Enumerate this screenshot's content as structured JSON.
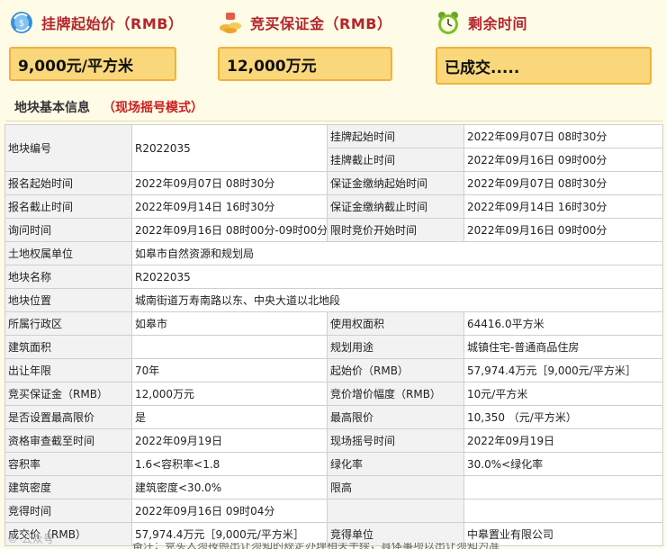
{
  "stats": {
    "price": {
      "label": "挂牌起始价（RMB）",
      "value": "9,000元/平方米",
      "icon": "money-exchange-icon"
    },
    "deposit": {
      "label": "竞买保证金（RMB）",
      "value": "12,000万元",
      "icon": "coins-icon"
    },
    "remaining": {
      "label": "剩余时间",
      "value": "已成交.....",
      "icon": "alarm-clock-icon"
    }
  },
  "section": {
    "title": "地块基本信息",
    "mode": "（现场摇号模式）"
  },
  "table": {
    "r1": {
      "k1": "地块编号",
      "v1": "R2022035",
      "k2a": "挂牌起始时间",
      "v2a": "2022年09月07日 08时30分",
      "k2b": "挂牌截止时间",
      "v2b": "2022年09月16日 09时00分"
    },
    "r2": {
      "k1": "报名起始时间",
      "v1": "2022年09月07日 08时30分",
      "k2": "保证金缴纳起始时间",
      "v2": "2022年09月07日 08时30分"
    },
    "r3": {
      "k1": "报名截止时间",
      "v1": "2022年09月14日 16时30分",
      "k2": "保证金缴纳截止时间",
      "v2": "2022年09月14日 16时30分"
    },
    "r4": {
      "k1": "询问时间",
      "v1": "2022年09月16日 08时00分-09时00分",
      "k2": "限时竞价开始时间",
      "v2": "2022年09月16日 09时00分"
    },
    "r5": {
      "k1": "土地权属单位",
      "v1": "如皋市自然资源和规划局"
    },
    "r6": {
      "k1": "地块名称",
      "v1": "R2022035"
    },
    "r7": {
      "k1": "地块位置",
      "v1": "城南街道万寿南路以东、中央大道以北地段"
    },
    "r8": {
      "k1": "所属行政区",
      "v1": "如皋市",
      "k2": "使用权面积",
      "v2": "64416.0平方米"
    },
    "r9": {
      "k1": "建筑面积",
      "v1": "",
      "k2": "规划用途",
      "v2": "城镇住宅-普通商品住房"
    },
    "r10": {
      "k1": "出让年限",
      "v1": "70年",
      "k2": "起始价（RMB）",
      "v2": "57,974.4万元［9,000元/平方米］"
    },
    "r11": {
      "k1": "竞买保证金（RMB）",
      "v1": "12,000万元",
      "k2": "竞价增价幅度（RMB）",
      "v2": "10元/平方米"
    },
    "r12": {
      "k1": "是否设置最高限价",
      "v1": "是",
      "k2": "最高限价",
      "v2": "10,350 （元/平方米）"
    },
    "r13": {
      "k1": "资格审查截至时间",
      "v1": "2022年09月19日",
      "k2": "现场摇号时间",
      "v2": "2022年09月19日"
    },
    "r14": {
      "k1": "容积率",
      "v1": "1.6<容积率<1.8",
      "k2": "绿化率",
      "v2": "30.0%<绿化率"
    },
    "r15": {
      "k1": "建筑密度",
      "v1": "建筑密度<30.0%",
      "k2": "限高",
      "v2": ""
    },
    "r16": {
      "k1": "竞得时间",
      "v1": "2022年09月16日 09时04分"
    },
    "r17": {
      "k1": "成交价（RMB）",
      "v1": "57,974.4万元［9,000元/平方米］",
      "k2": "竞得单位",
      "v2": "中皋置业有限公司"
    }
  },
  "watermark": "© 公众号",
  "footer_note": "备注：竞买人须按照出让须知的规定办理相关手续，具体事项以出让须知为准"
}
